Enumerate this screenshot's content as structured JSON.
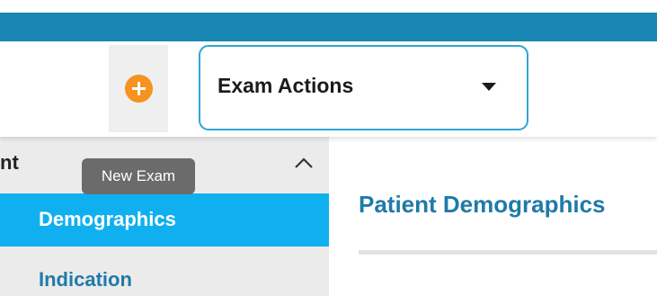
{
  "colors": {
    "brand_bar": "#1a86b3",
    "add_button_accent": "#f6921e",
    "dropdown_border": "#2fa5d8",
    "active_nav_bg": "#10b0f0",
    "link_text": "#1f7aa9",
    "tooltip_bg": "#6b6b6b"
  },
  "toolbar": {
    "add_icon": "plus-icon",
    "exam_actions": {
      "label": "Exam Actions",
      "icon": "caret-down-icon"
    }
  },
  "tooltip": {
    "text": "New Exam"
  },
  "sidebar": {
    "section_title": "nt",
    "collapse_icon": "chevron-up-icon",
    "items": [
      {
        "label": "Demographics",
        "active": true
      },
      {
        "label": "Indication",
        "active": false
      }
    ]
  },
  "main": {
    "title": "Patient Demographics"
  }
}
